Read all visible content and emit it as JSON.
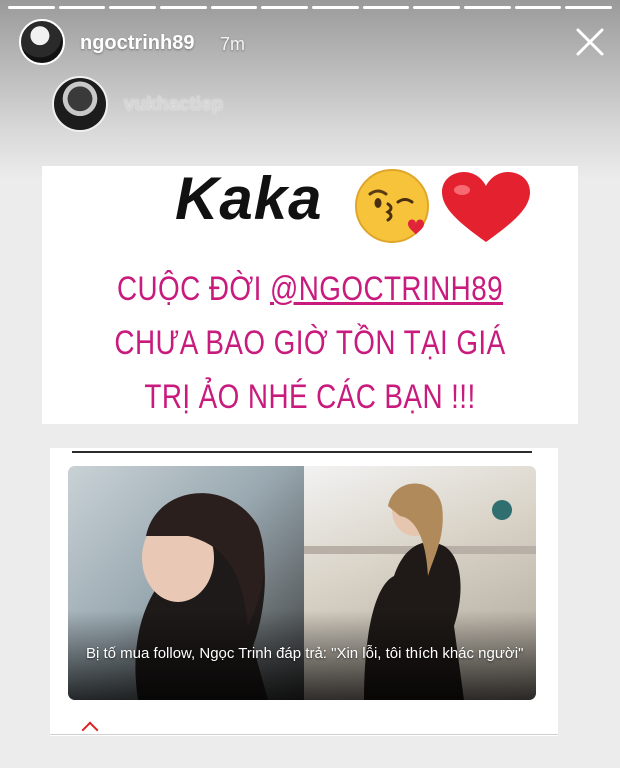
{
  "story": {
    "progress": {
      "segments": 12,
      "active_index": 11
    },
    "header": {
      "username": "ngoctrinh89",
      "time": "7m"
    },
    "mention": {
      "username": "vukhactiep"
    }
  },
  "post": {
    "headline": "Kaka",
    "statement": {
      "line1_prefix": "CUỘC ĐỜI ",
      "line1_handle": "@NGOCTRINH89",
      "line2": "CHƯA BAO GIỜ TỒN TẠI GIÁ",
      "line3": "TRỊ ẢO NHÉ CÁC BẠN !!!"
    },
    "statement_color": "#c81b7d"
  },
  "article": {
    "caption": "Bị tố mua follow, Ngọc Trinh đáp trả: \"Xin lỗi, tôi thích khác người\""
  }
}
